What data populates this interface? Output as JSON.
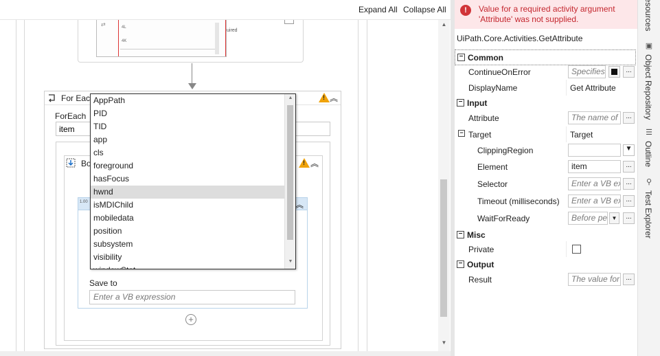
{
  "toolbar": {
    "expand_all": "Expand All",
    "collapse_all": "Collapse All"
  },
  "top_activity": {
    "required_text": "uired",
    "rows": [
      "4L",
      "4K"
    ]
  },
  "foreach": {
    "title": "For Each",
    "foreach_label": "ForEach",
    "item_value": "item",
    "body_title": "Bo",
    "get_attribute": {
      "save_to_label": "Save to",
      "save_to_placeholder": "Enter a VB expression"
    }
  },
  "attribute_dropdown": {
    "items": [
      "AppPath",
      "PID",
      "TID",
      "app",
      "cls",
      "foreground",
      "hasFocus",
      "hwnd",
      "isMDIChild",
      "mobiledata",
      "position",
      "subsystem",
      "visibility"
    ],
    "selected": "hwnd"
  },
  "properties": {
    "error": "Value for a required activity argument 'Attribute' was not supplied.",
    "type_name": "UiPath.Core.Activities.GetAttribute",
    "categories": {
      "common": {
        "label": "Common",
        "continue_on_error": {
          "name": "ContinueOnError",
          "placeholder": "Specifies"
        },
        "display_name": {
          "name": "DisplayName",
          "value": "Get Attribute"
        }
      },
      "input": {
        "label": "Input",
        "attribute": {
          "name": "Attribute",
          "placeholder": "The name of"
        },
        "target": {
          "name": "Target",
          "value": "Target"
        },
        "clipping_region": {
          "name": "ClippingRegion",
          "value": ""
        },
        "element": {
          "name": "Element",
          "value": "item"
        },
        "selector": {
          "name": "Selector",
          "placeholder": "Enter a VB ex"
        },
        "timeout": {
          "name": "Timeout (milliseconds)",
          "placeholder": "Enter a VB ex"
        },
        "wait_for_ready": {
          "name": "WaitForReady",
          "placeholder": "Before pe"
        }
      },
      "misc": {
        "label": "Misc",
        "private": {
          "name": "Private",
          "checked": false
        }
      },
      "output": {
        "label": "Output",
        "result": {
          "name": "Result",
          "placeholder": "The value for"
        }
      }
    }
  },
  "rail": {
    "resources": "Resources",
    "object_repository": "Object Repository",
    "outline": "Outline",
    "test_explorer": "Test Explorer"
  },
  "colors": {
    "error_bg": "#fde7e9",
    "error_text": "#c4262e",
    "warning": "#f0a30a",
    "selection": "#dddddd",
    "activity_header": "#d7e7f6"
  }
}
